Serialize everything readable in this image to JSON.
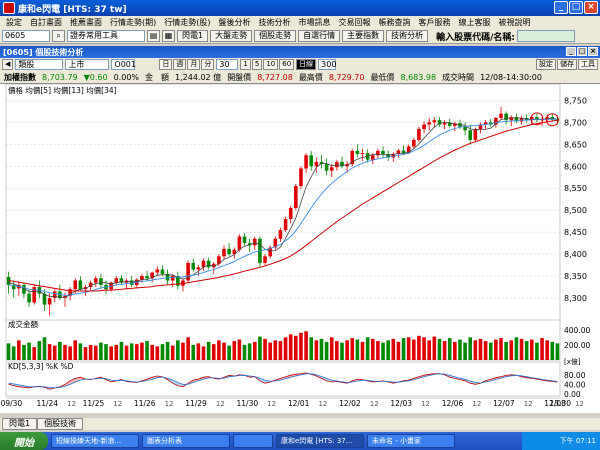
{
  "window": {
    "title": "康和e閃電 [HTS: 37 tw]"
  },
  "menu": [
    "設定",
    "自訂畫面",
    "推薦畫面",
    "行情走勢(期)",
    "行情走勢(股)",
    "盤後分析",
    "技術分析",
    "市場訊息",
    "交易回報",
    "帳務查詢",
    "客戶服務",
    "線上客服",
    "被視說明"
  ],
  "toolbar": {
    "code_value": "0605",
    "tool_select": "證券常用工具",
    "buttons": [
      "閃電1",
      "大盤走勢",
      "個股走勢",
      "自選行情",
      "主要指數",
      "技術分析"
    ],
    "code_label": "輸入股票代碼/名稱:"
  },
  "subwindow": {
    "title": "[0605] 個股技術分析"
  },
  "controls": {
    "category": "類股",
    "market": "上市",
    "index_code": "O001",
    "periods": [
      "日",
      "週",
      "月",
      "分"
    ],
    "minute": "30",
    "minute_opts": [
      "1",
      "5",
      "10",
      "60"
    ],
    "active": "日線",
    "count": "300",
    "right_buttons": [
      "設定",
      "儲存",
      "工具"
    ]
  },
  "info": {
    "name": "加權指數",
    "price": "8,703.79",
    "change": "▼0.60",
    "pct": "0.00%",
    "vol_label": "金　額",
    "vol": "1,244.02 億",
    "open_label": "開盤價",
    "open": "8,727.08",
    "high_label": "最高價",
    "high": "8,729.70",
    "low_label": "最低價",
    "low": "8,683.98",
    "time_label": "成交時間",
    "time": "12/08-14:30:00"
  },
  "chart_data": {
    "type": "candlestick",
    "legend": "價格 均價[5] 均價[13] 均價[34]",
    "ylim": [
      8250,
      8760
    ],
    "y_ticks": [
      8300,
      8350,
      8400,
      8450,
      8500,
      8550,
      8600,
      8650,
      8700,
      8750
    ],
    "y_tick_labels": [
      "8,300",
      "8,350",
      "8,400",
      "8,450",
      "8,500",
      "8,550",
      "8,600",
      "8,650",
      "8,700",
      "8,750"
    ],
    "x_labels": [
      "09/30",
      "11/24",
      "11/25",
      "11/26",
      "11/29",
      "11/30",
      "12/01",
      "12/02",
      "12/03",
      "12/06",
      "12/07",
      "12/08",
      "13:30"
    ],
    "x_label_idx": [
      0,
      7,
      16,
      26,
      36,
      46,
      56,
      66,
      76,
      86,
      96,
      106,
      116
    ],
    "x_hour_label": "12",
    "candles": [
      [
        8348,
        8360,
        8310,
        8330
      ],
      [
        8330,
        8340,
        8300,
        8320
      ],
      [
        8322,
        8338,
        8305,
        8330
      ],
      [
        8330,
        8335,
        8300,
        8310
      ],
      [
        8310,
        8320,
        8280,
        8290
      ],
      [
        8290,
        8330,
        8285,
        8325
      ],
      [
        8325,
        8340,
        8300,
        8310
      ],
      [
        8310,
        8320,
        8270,
        8285
      ],
      [
        8285,
        8310,
        8260,
        8300
      ],
      [
        8300,
        8320,
        8290,
        8315
      ],
      [
        8315,
        8330,
        8295,
        8300
      ],
      [
        8300,
        8312,
        8280,
        8305
      ],
      [
        8305,
        8325,
        8295,
        8320
      ],
      [
        8320,
        8345,
        8310,
        8340
      ],
      [
        8340,
        8350,
        8315,
        8320
      ],
      [
        8320,
        8330,
        8305,
        8325
      ],
      [
        8325,
        8340,
        8318,
        8335
      ],
      [
        8335,
        8350,
        8325,
        8345
      ],
      [
        8345,
        8355,
        8320,
        8330
      ],
      [
        8330,
        8340,
        8310,
        8320
      ],
      [
        8320,
        8338,
        8315,
        8335
      ],
      [
        8335,
        8350,
        8328,
        8345
      ],
      [
        8345,
        8352,
        8330,
        8335
      ],
      [
        8335,
        8345,
        8320,
        8340
      ],
      [
        8340,
        8350,
        8325,
        8330
      ],
      [
        8330,
        8345,
        8322,
        8342
      ],
      [
        8342,
        8355,
        8335,
        8350
      ],
      [
        8350,
        8362,
        8340,
        8345
      ],
      [
        8345,
        8360,
        8336,
        8358
      ],
      [
        8358,
        8372,
        8350,
        8365
      ],
      [
        8365,
        8375,
        8350,
        8355
      ],
      [
        8355,
        8365,
        8330,
        8340
      ],
      [
        8340,
        8355,
        8325,
        8350
      ],
      [
        8350,
        8360,
        8320,
        8328
      ],
      [
        8328,
        8345,
        8315,
        8340
      ],
      [
        8340,
        8385,
        8335,
        8380
      ],
      [
        8380,
        8390,
        8360,
        8365
      ],
      [
        8365,
        8375,
        8350,
        8370
      ],
      [
        8370,
        8390,
        8362,
        8385
      ],
      [
        8385,
        8392,
        8365,
        8370
      ],
      [
        8370,
        8382,
        8355,
        8378
      ],
      [
        8378,
        8400,
        8372,
        8395
      ],
      [
        8395,
        8420,
        8388,
        8412
      ],
      [
        8412,
        8425,
        8395,
        8400
      ],
      [
        8400,
        8415,
        8390,
        8410
      ],
      [
        8410,
        8445,
        8405,
        8440
      ],
      [
        8440,
        8448,
        8420,
        8425
      ],
      [
        8425,
        8435,
        8405,
        8420
      ],
      [
        8420,
        8440,
        8410,
        8435
      ],
      [
        8435,
        8440,
        8370,
        8380
      ],
      [
        8380,
        8400,
        8375,
        8395
      ],
      [
        8395,
        8420,
        8390,
        8415
      ],
      [
        8415,
        8440,
        8410,
        8435
      ],
      [
        8435,
        8460,
        8428,
        8455
      ],
      [
        8455,
        8485,
        8450,
        8480
      ],
      [
        8480,
        8510,
        8470,
        8505
      ],
      [
        8505,
        8560,
        8500,
        8555
      ],
      [
        8555,
        8600,
        8548,
        8595
      ],
      [
        8595,
        8630,
        8585,
        8625
      ],
      [
        8625,
        8635,
        8590,
        8600
      ],
      [
        8600,
        8620,
        8585,
        8610
      ],
      [
        8610,
        8625,
        8595,
        8605
      ],
      [
        8605,
        8618,
        8580,
        8590
      ],
      [
        8590,
        8605,
        8575,
        8598
      ],
      [
        8598,
        8615,
        8590,
        8610
      ],
      [
        8610,
        8622,
        8595,
        8600
      ],
      [
        8600,
        8612,
        8585,
        8605
      ],
      [
        8605,
        8640,
        8600,
        8635
      ],
      [
        8635,
        8650,
        8620,
        8628
      ],
      [
        8628,
        8640,
        8612,
        8630
      ],
      [
        8630,
        8638,
        8608,
        8615
      ],
      [
        8615,
        8630,
        8605,
        8625
      ],
      [
        8625,
        8640,
        8618,
        8635
      ],
      [
        8635,
        8645,
        8620,
        8628
      ],
      [
        8628,
        8636,
        8612,
        8620
      ],
      [
        8620,
        8632,
        8610,
        8628
      ],
      [
        8628,
        8640,
        8620,
        8636
      ],
      [
        8636,
        8648,
        8625,
        8630
      ],
      [
        8630,
        8650,
        8628,
        8645
      ],
      [
        8645,
        8665,
        8640,
        8660
      ],
      [
        8660,
        8690,
        8655,
        8685
      ],
      [
        8685,
        8702,
        8675,
        8695
      ],
      [
        8695,
        8710,
        8682,
        8700
      ],
      [
        8700,
        8712,
        8688,
        8705
      ],
      [
        8705,
        8712,
        8690,
        8695
      ],
      [
        8695,
        8705,
        8685,
        8700
      ],
      [
        8700,
        8708,
        8688,
        8692
      ],
      [
        8692,
        8702,
        8680,
        8698
      ],
      [
        8698,
        8706,
        8685,
        8690
      ],
      [
        8690,
        8700,
        8670,
        8682
      ],
      [
        8682,
        8695,
        8650,
        8660
      ],
      [
        8660,
        8688,
        8655,
        8685
      ],
      [
        8685,
        8700,
        8675,
        8695
      ],
      [
        8695,
        8705,
        8685,
        8700
      ],
      [
        8700,
        8708,
        8690,
        8695
      ],
      [
        8695,
        8712,
        8688,
        8710
      ],
      [
        8710,
        8735,
        8705,
        8720
      ],
      [
        8720,
        8725,
        8695,
        8705
      ],
      [
        8705,
        8716,
        8692,
        8712
      ],
      [
        8712,
        8720,
        8698,
        8702
      ],
      [
        8702,
        8715,
        8695,
        8710
      ],
      [
        8710,
        8718,
        8700,
        8706
      ],
      [
        8706,
        8715,
        8695,
        8712
      ],
      [
        8712,
        8720,
        8700,
        8705
      ],
      [
        8705,
        8712,
        8692,
        8708
      ],
      [
        8708,
        8718,
        8700,
        8712
      ],
      [
        8712,
        8720,
        8702,
        8708
      ],
      [
        8708,
        8716,
        8695,
        8704
      ]
    ],
    "ma5": [
      8335,
      8332,
      8328,
      8322,
      8314,
      8315,
      8316,
      8308,
      8304,
      8303,
      8302,
      8301,
      8308,
      8316,
      8320,
      8322,
      8328,
      8333,
      8335,
      8335,
      8332,
      8335,
      8337,
      8337,
      8338,
      8338,
      8342,
      8342,
      8347,
      8352,
      8353,
      8353,
      8352,
      8348,
      8343,
      8347,
      8353,
      8361,
      8370,
      8376,
      8372,
      8378,
      8388,
      8393,
      8399,
      8411,
      8418,
      8421,
      8426,
      8422,
      8411,
      8407,
      8408,
      8416,
      8436,
      8458,
      8482,
      8518,
      8553,
      8576,
      8597,
      8607,
      8606,
      8601,
      8603,
      8603,
      8602,
      8610,
      8616,
      8620,
      8623,
      8627,
      8627,
      8627,
      8625,
      8627,
      8629,
      8629,
      8632,
      8640,
      8651,
      8664,
      8677,
      8689,
      8698,
      8700,
      8699,
      8696,
      8695,
      8693,
      8685,
      8683,
      8684,
      8684,
      8687,
      8697,
      8706,
      8709,
      8710,
      8710,
      8710,
      8707,
      8707,
      8707,
      8707,
      8708,
      8709,
      8707
    ],
    "ma13": [
      8330,
      8328,
      8326,
      8324,
      8320,
      8319,
      8318,
      8315,
      8312,
      8310,
      8308,
      8306,
      8307,
      8309,
      8311,
      8313,
      8316,
      8320,
      8323,
      8325,
      8327,
      8330,
      8331,
      8333,
      8334,
      8336,
      8338,
      8339,
      8341,
      8343,
      8345,
      8346,
      8347,
      8348,
      8348,
      8350,
      8352,
      8355,
      8358,
      8362,
      8365,
      8369,
      8374,
      8378,
      8383,
      8389,
      8395,
      8400,
      8405,
      8407,
      8410,
      8413,
      8417,
      8422,
      8430,
      8440,
      8453,
      8470,
      8488,
      8505,
      8522,
      8537,
      8550,
      8561,
      8571,
      8580,
      8588,
      8596,
      8602,
      8607,
      8611,
      8614,
      8617,
      8619,
      8621,
      8623,
      8625,
      8627,
      8630,
      8635,
      8641,
      8648,
      8656,
      8664,
      8671,
      8677,
      8682,
      8686,
      8689,
      8691,
      8692,
      8693,
      8694,
      8695,
      8697,
      8699,
      8701,
      8702,
      8703,
      8704,
      8705,
      8705,
      8706,
      8706,
      8706,
      8707,
      8707,
      8707
    ],
    "ma34": [
      8340,
      8338,
      8336,
      8334,
      8332,
      8330,
      8328,
      8326,
      8324,
      8322,
      8320,
      8318,
      8317,
      8316,
      8316,
      8316,
      8316,
      8316,
      8317,
      8318,
      8318,
      8319,
      8320,
      8321,
      8322,
      8323,
      8324,
      8325,
      8326,
      8328,
      8329,
      8330,
      8331,
      8332,
      8333,
      8335,
      8337,
      8339,
      8341,
      8343,
      8345,
      8347,
      8350,
      8352,
      8355,
      8358,
      8361,
      8364,
      8367,
      8370,
      8373,
      8377,
      8381,
      8385,
      8390,
      8396,
      8403,
      8411,
      8420,
      8429,
      8438,
      8447,
      8456,
      8465,
      8474,
      8482,
      8490,
      8498,
      8506,
      8514,
      8521,
      8528,
      8535,
      8542,
      8549,
      8556,
      8563,
      8570,
      8577,
      8584,
      8591,
      8598,
      8605,
      8612,
      8619,
      8625,
      8631,
      8637,
      8642,
      8647,
      8652,
      8656,
      8660,
      8664,
      8668,
      8672,
      8676,
      8680,
      8683,
      8686,
      8689,
      8692,
      8695,
      8697,
      8699,
      8701,
      8703,
      8705
    ],
    "volume_label": "成交金額",
    "volume_ylim": [
      0,
      450
    ],
    "volume_ticks": [
      "400.00",
      "200.00"
    ],
    "volume_unit": "[x億]",
    "volume": [
      220,
      180,
      260,
      200,
      230,
      170,
      250,
      300,
      210,
      190,
      240,
      200,
      180,
      260,
      220,
      170,
      200,
      190,
      230,
      210,
      180,
      200,
      240,
      190,
      220,
      210,
      230,
      250,
      200,
      180,
      210,
      240,
      190,
      260,
      230,
      300,
      200,
      220,
      180,
      240,
      210,
      260,
      230,
      190,
      250,
      270,
      200,
      220,
      240,
      310,
      280,
      230,
      260,
      250,
      300,
      340,
      320,
      360,
      380,
      300,
      260,
      280,
      240,
      300,
      250,
      230,
      260,
      290,
      270,
      240,
      300,
      280,
      250,
      230,
      260,
      280,
      240,
      290,
      300,
      270,
      320,
      300,
      260,
      310,
      280,
      250,
      290,
      240,
      270,
      230,
      300,
      260,
      280,
      250,
      230,
      270,
      290,
      240,
      260,
      300,
      280,
      250,
      270,
      230,
      290,
      260,
      240,
      220
    ],
    "kd_label": "KD[5,3,3] %K %D",
    "kd_ylim": [
      0,
      100
    ],
    "kd_ticks": [
      "80.00",
      "40.00",
      "0.00"
    ],
    "k": [
      40,
      35,
      30,
      28,
      25,
      30,
      32,
      28,
      20,
      25,
      30,
      40,
      55,
      65,
      70,
      62,
      60,
      65,
      70,
      60,
      50,
      55,
      60,
      52,
      50,
      48,
      55,
      62,
      70,
      75,
      72,
      60,
      45,
      35,
      30,
      45,
      58,
      62,
      70,
      72,
      65,
      62,
      70,
      78,
      75,
      80,
      78,
      70,
      72,
      55,
      45,
      50,
      58,
      65,
      72,
      78,
      82,
      85,
      88,
      82,
      75,
      65,
      55,
      50,
      52,
      48,
      45,
      55,
      62,
      60,
      55,
      50,
      52,
      55,
      50,
      45,
      50,
      55,
      58,
      65,
      72,
      78,
      82,
      85,
      85,
      80,
      70,
      65,
      60,
      55,
      45,
      40,
      45,
      55,
      62,
      68,
      72,
      78,
      80,
      78,
      72,
      68,
      65,
      62,
      58,
      55,
      52,
      50
    ],
    "d": [
      45,
      42,
      38,
      34,
      30,
      30,
      31,
      30,
      27,
      26,
      27,
      32,
      40,
      50,
      58,
      62,
      62,
      63,
      66,
      64,
      58,
      56,
      57,
      55,
      52,
      50,
      52,
      56,
      62,
      68,
      71,
      66,
      58,
      48,
      40,
      41,
      48,
      56,
      62,
      67,
      67,
      65,
      66,
      72,
      74,
      77,
      78,
      75,
      73,
      66,
      58,
      53,
      54,
      58,
      64,
      70,
      75,
      80,
      84,
      84,
      80,
      73,
      65,
      58,
      54,
      51,
      48,
      50,
      54,
      57,
      57,
      54,
      52,
      53,
      52,
      49,
      49,
      52,
      55,
      60,
      66,
      72,
      77,
      82,
      84,
      83,
      78,
      72,
      66,
      61,
      54,
      48,
      46,
      50,
      55,
      61,
      66,
      72,
      76,
      78,
      76,
      72,
      68,
      65,
      61,
      58,
      55,
      52
    ]
  },
  "bottom_tabs": [
    "閃電1",
    "個股技術"
  ],
  "taskbar": {
    "start": "開始",
    "tasks": [
      "短線操練天地-新浪...",
      "圖表分析表",
      "",
      "康和e閃電 [HTS: 37...",
      "未命名 - 小畫家"
    ],
    "clock": "下午 07:11"
  }
}
